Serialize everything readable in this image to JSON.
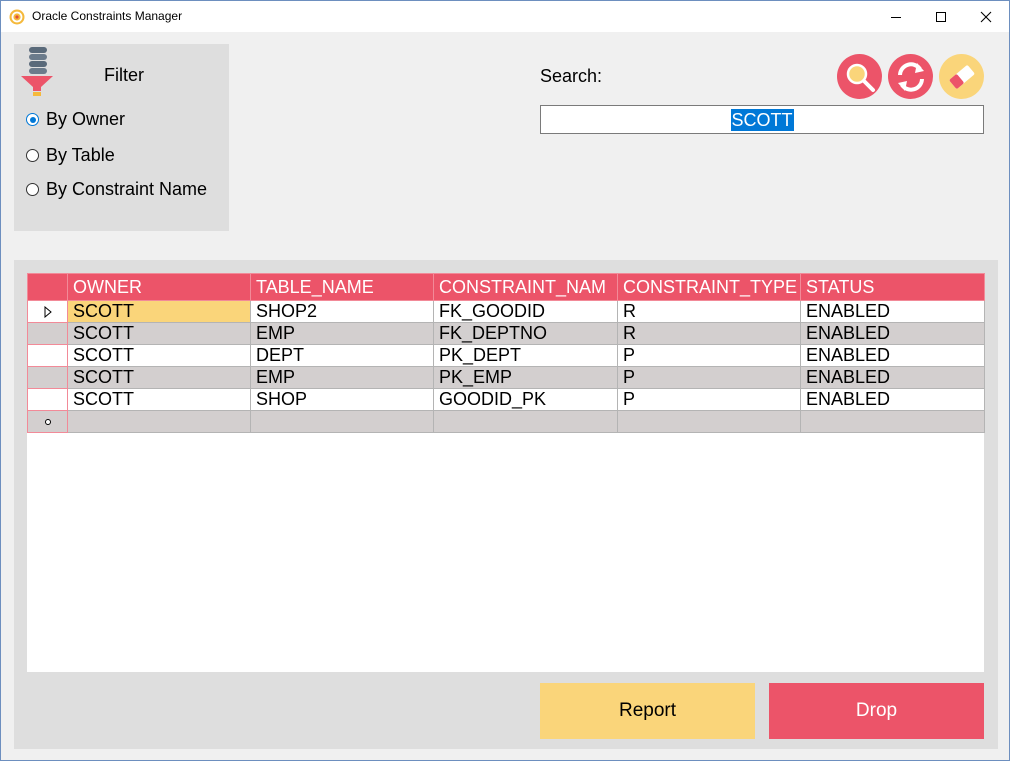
{
  "window": {
    "title": "Oracle Constraints Manager",
    "app_icon": "oracle-app-icon",
    "controls": [
      "minimize-icon",
      "maximize-icon",
      "close-icon"
    ]
  },
  "filter": {
    "title": "Filter",
    "icon": "database-filter-icon",
    "options": [
      {
        "label": "By Owner",
        "checked": true
      },
      {
        "label": "By Table",
        "checked": false
      },
      {
        "label": "By Constraint Name",
        "checked": false
      }
    ]
  },
  "search": {
    "label": "Search:",
    "value": "SCOTT",
    "buttons": [
      "search-icon",
      "refresh-icon",
      "eraser-icon"
    ]
  },
  "grid": {
    "columns": [
      "OWNER",
      "TABLE_NAME",
      "CONSTRAINT_NAM",
      "CONSTRAINT_TYPE",
      "STATUS"
    ],
    "rows": [
      [
        "SCOTT",
        "SHOP2",
        "FK_GOODID",
        "R",
        "ENABLED"
      ],
      [
        "SCOTT",
        "EMP",
        "FK_DEPTNO",
        "R",
        "ENABLED"
      ],
      [
        "SCOTT",
        "DEPT",
        "PK_DEPT",
        "P",
        "ENABLED"
      ],
      [
        "SCOTT",
        "EMP",
        "PK_EMP",
        "P",
        "ENABLED"
      ],
      [
        "SCOTT",
        "SHOP",
        "GOODID_PK",
        "P",
        "ENABLED"
      ]
    ]
  },
  "actions": {
    "report_label": "Report",
    "drop_label": "Drop"
  },
  "colors": {
    "accent_red": "#ec5469",
    "accent_yellow": "#fad57a",
    "alt_row": "#d3cfcf",
    "selection_blue": "#0078d7"
  }
}
